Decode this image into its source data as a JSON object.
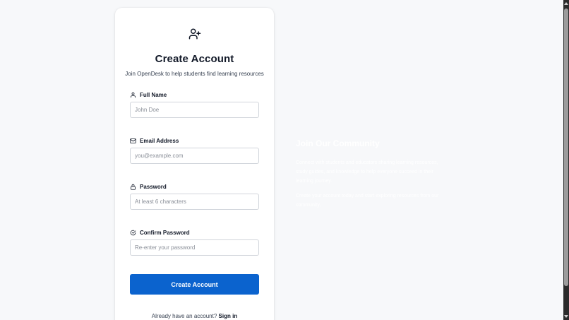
{
  "header": {
    "icon": "user-plus-icon",
    "title": "Create Account",
    "subtitle": "Join OpenDesk to help students find learning resources"
  },
  "form": {
    "fields": [
      {
        "icon": "user-icon",
        "label": "Full Name",
        "placeholder": "John Doe",
        "value": ""
      },
      {
        "icon": "mail-icon",
        "label": "Email Address",
        "placeholder": "you@example.com",
        "value": ""
      },
      {
        "icon": "lock-icon",
        "label": "Password",
        "placeholder": "At least 6 characters",
        "value": ""
      },
      {
        "icon": "check-circle-icon",
        "label": "Confirm Password",
        "placeholder": "Re-enter your password",
        "value": ""
      }
    ],
    "submit_label": "Create Account",
    "signin_prompt": "Already have an account? ",
    "signin_link": "Sign in"
  },
  "community": {
    "title": "Join Our Community",
    "paragraph_1": "Connect with students and educators sharing learning resources, study guides, and knowledge to help everyone succeed in their learning journey.",
    "paragraph_2": "Create your account today and start exploring resources from our community."
  },
  "colors": {
    "page_background": "#f7f8fa",
    "card_background": "#ffffff",
    "primary_button": "#0b63ce",
    "community_text": "#ffffff"
  }
}
